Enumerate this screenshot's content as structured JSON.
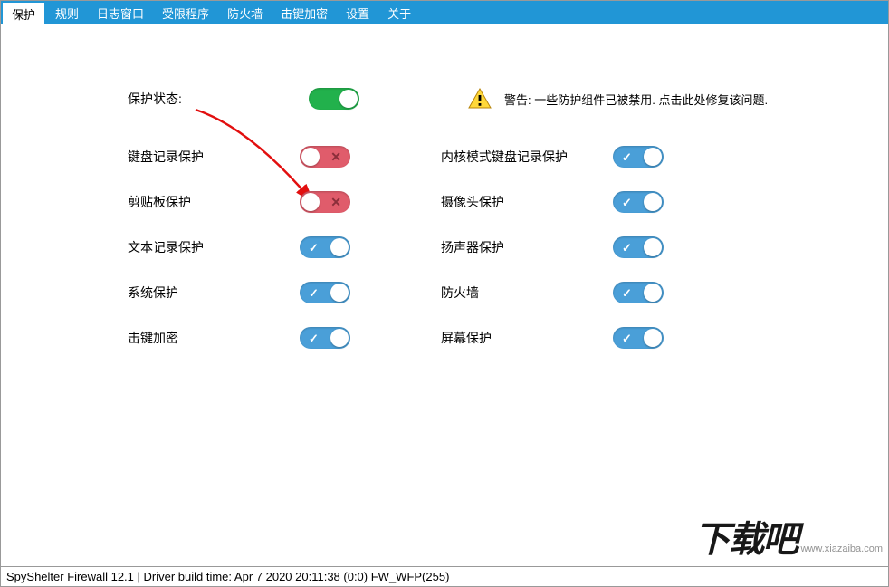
{
  "menubar": {
    "items": [
      {
        "label": "保护",
        "active": true
      },
      {
        "label": "规则",
        "active": false
      },
      {
        "label": "日志窗口",
        "active": false
      },
      {
        "label": "受限程序",
        "active": false
      },
      {
        "label": "防火墙",
        "active": false
      },
      {
        "label": "击键加密",
        "active": false
      },
      {
        "label": "设置",
        "active": false
      },
      {
        "label": "关于",
        "active": false
      }
    ]
  },
  "status": {
    "label": "保护状态:",
    "state": "on"
  },
  "warning": {
    "text": "警告: 一些防护组件已被禁用. 点击此处修复该问题."
  },
  "left_col": [
    {
      "label": "键盘记录保护",
      "state": "off-red"
    },
    {
      "label": "剪贴板保护",
      "state": "off-red"
    },
    {
      "label": "文本记录保护",
      "state": "on-blue"
    },
    {
      "label": "系统保护",
      "state": "on-blue"
    },
    {
      "label": "击键加密",
      "state": "on-blue"
    }
  ],
  "right_col": [
    {
      "label": "内核模式键盘记录保护",
      "state": "on-blue"
    },
    {
      "label": "摄像头保护",
      "state": "on-blue"
    },
    {
      "label": "扬声器保护",
      "state": "on-blue"
    },
    {
      "label": "防火墙",
      "state": "on-blue"
    },
    {
      "label": "屏幕保护",
      "state": "on-blue"
    }
  ],
  "statusbar": {
    "text": "SpyShelter Firewall 12.1   |   Driver build time: Apr   7 2020 20:11:38  (0:0) FW_WFP(255)"
  },
  "watermark": {
    "big": "下载吧",
    "url": "www.xiazaiba.com"
  }
}
